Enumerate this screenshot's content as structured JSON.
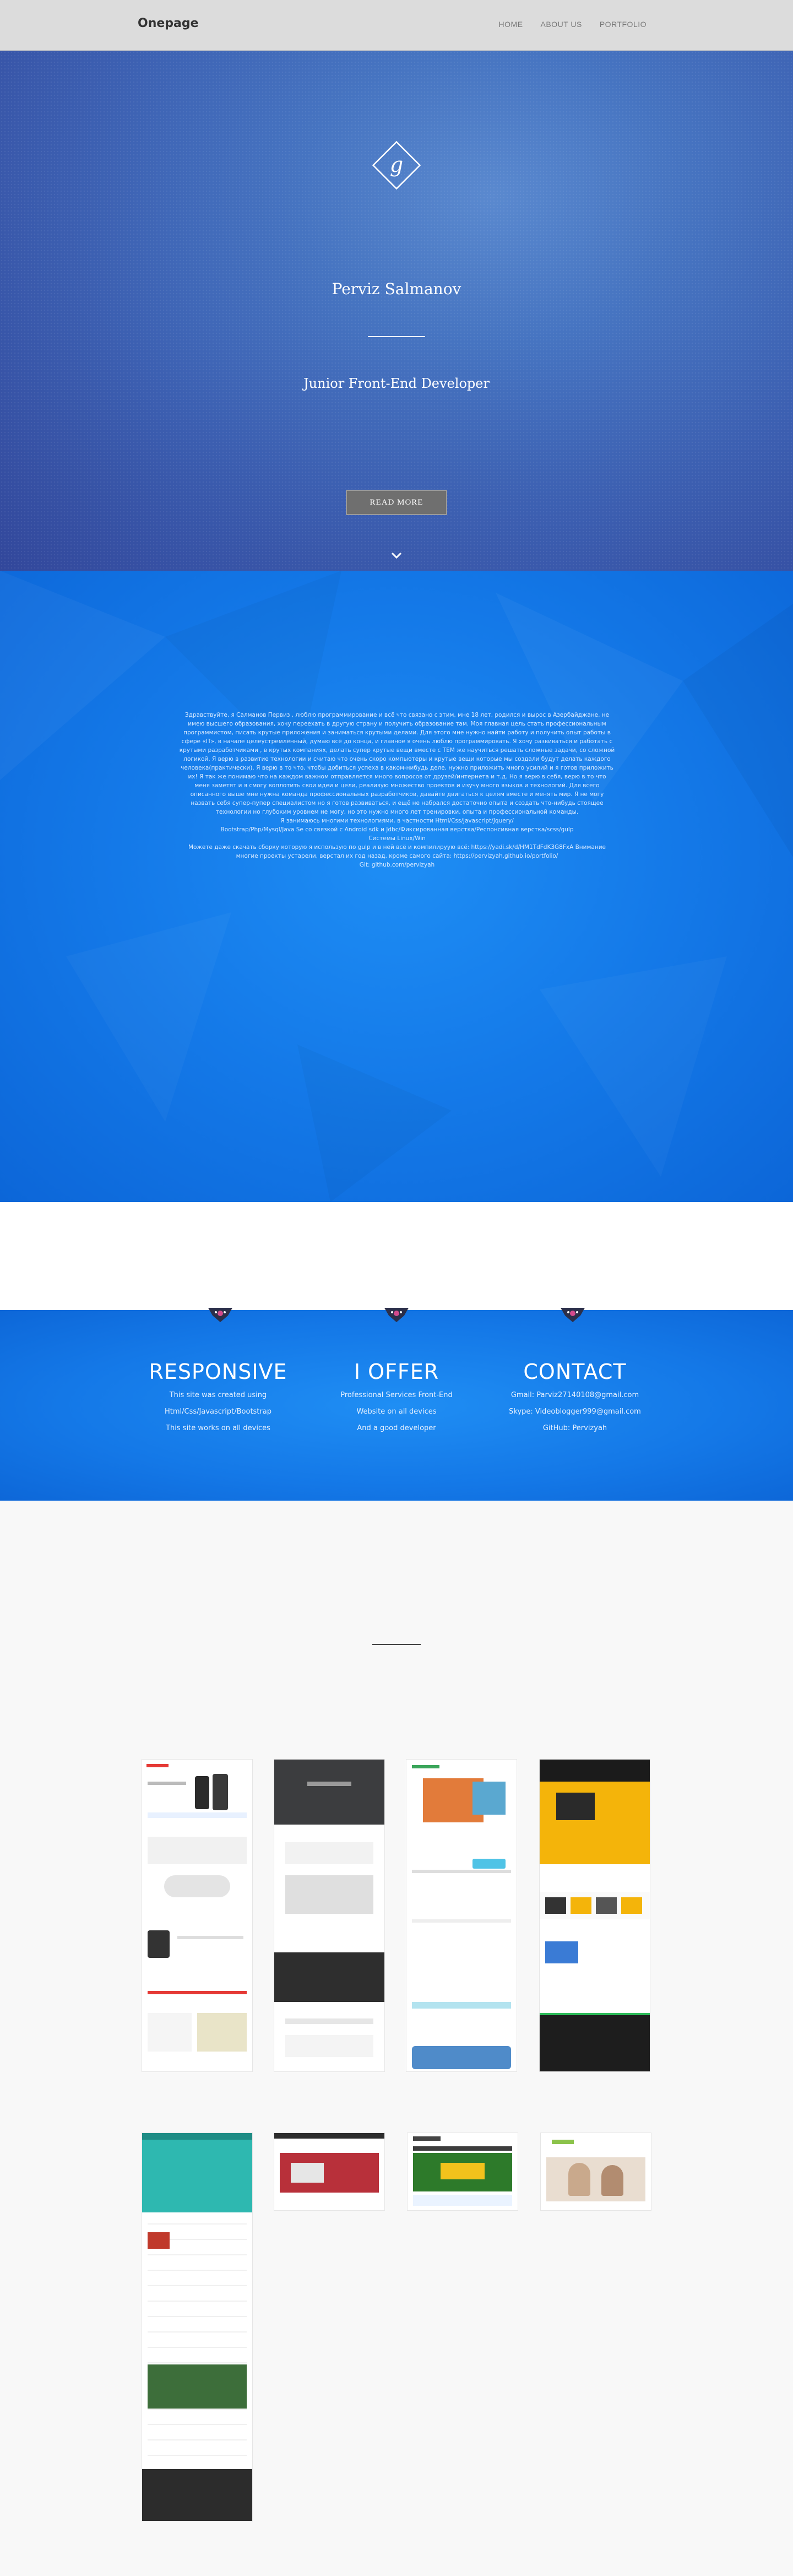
{
  "navbar": {
    "brand": "Onepage",
    "links": [
      "HOME",
      "ABOUT US",
      "PORTFOLIO"
    ]
  },
  "hero": {
    "logo_letter": "g",
    "name": "Perviz Salmanov",
    "title": "Junior Front-End Developer",
    "button_label": "READ MORE"
  },
  "about": {
    "lines": [
      "Здравствуйте, я Салманов Первиз , люблю программирование и всё что связано с этим, мне 18 лет, родился и вырос в Азербайджане, не",
      "имею высшего образования, хочу переехать в другую страну и получить образование там. Моя главная цель стать профессиональным",
      "программистом, писать крутые приложения и заниматься крутыми делами. Для этого мне нужно найти работу и получить опыт работы в",
      "сфере «IT», в начале целеустремлённый, думаю всё до конца, и главное я очень люблю программировать. Я хочу развиваться и работать с",
      "крутыми разработчиками , в крутых компаниях, делать супер крутые вещи вместе с ТЕМ же научиться решать сложные задачи, со сложной",
      "логикой. Я верю в развитие технологии и считаю что очень скоро компьютеры и крутые вещи которые мы создали будут делать каждого",
      "человека(практически). Я верю в то что, чтобы добиться успеха в каком-нибудь деле, нужно приложить много усилий и я готов приложить",
      "их! Я так же понимаю что на каждом важном отправляется много вопросов от друзей/интернета и т.д. Но я верю в себя, верю в то что",
      "меня заметят и я смогу воплотить свои идеи и цели, реализую множество проектов и изучу много языков и технологий. Для всего",
      "описанного выше мне нужна команда профессиональных разработчиков, давайте двигаться к целям вместе и менять мир. Я не могу",
      "назвать себя супер-пупер специалистом но я готов развиваться, и ещё не набрался достаточно опыта и создать что-нибудь стоящее",
      "технологии но глубоким уровнем не могу, но это нужно много лет тренировки, опыта и профессиональной команды.",
      "Я занимаюсь многими технологиями, в частности Html/Css/Javascript/Jquery/",
      "Bootstrap/Php/Mysql/Java Se со связкой с Android sdk и Jdbc/Фиксированная верстка/Респонсивная верстка/scss/gulp",
      "Системы Linux/Win",
      "Можете даже скачать сборку которую я использую по gulp и в ней всё и компилируую всё: https://yadi.sk/d/HM1TdFdK3G8FxA Внимание",
      "многие проекты устарели, верстал их год назад, кроме самого сайта: https://pervizyah.github.io/portfolio/",
      "Git: github.com/pervizyah"
    ]
  },
  "features": [
    {
      "title": "RESPONSIVE",
      "items": [
        "This site was created using",
        "Html/Css/Javascript/Bootstrap",
        "This site works on all devices"
      ]
    },
    {
      "title": "I OFFER",
      "items": [
        "Professional Services Front-End",
        "Website on all devices",
        "And a good developer"
      ]
    },
    {
      "title": "CONTACT",
      "items": [
        "Gmail: Parviz27140108@gmail.com",
        "Skype: Videoblogger999@gmail.com",
        "GitHub: Pervizyah"
      ]
    }
  ],
  "portfolio": {
    "items": [
      "apple-store-site",
      "dark-agency-site",
      "product-landing-site",
      "business-yellow-site",
      "awesome-free-psd-site",
      "red-slider-site",
      "green-shop-site",
      "wedding-photo-site"
    ]
  },
  "colors": {
    "hero_blue": "#3c5fb1",
    "section_blue": "#1479e8",
    "navbar_gray": "#dcdcdc",
    "button_gray": "#6f6f6f"
  }
}
